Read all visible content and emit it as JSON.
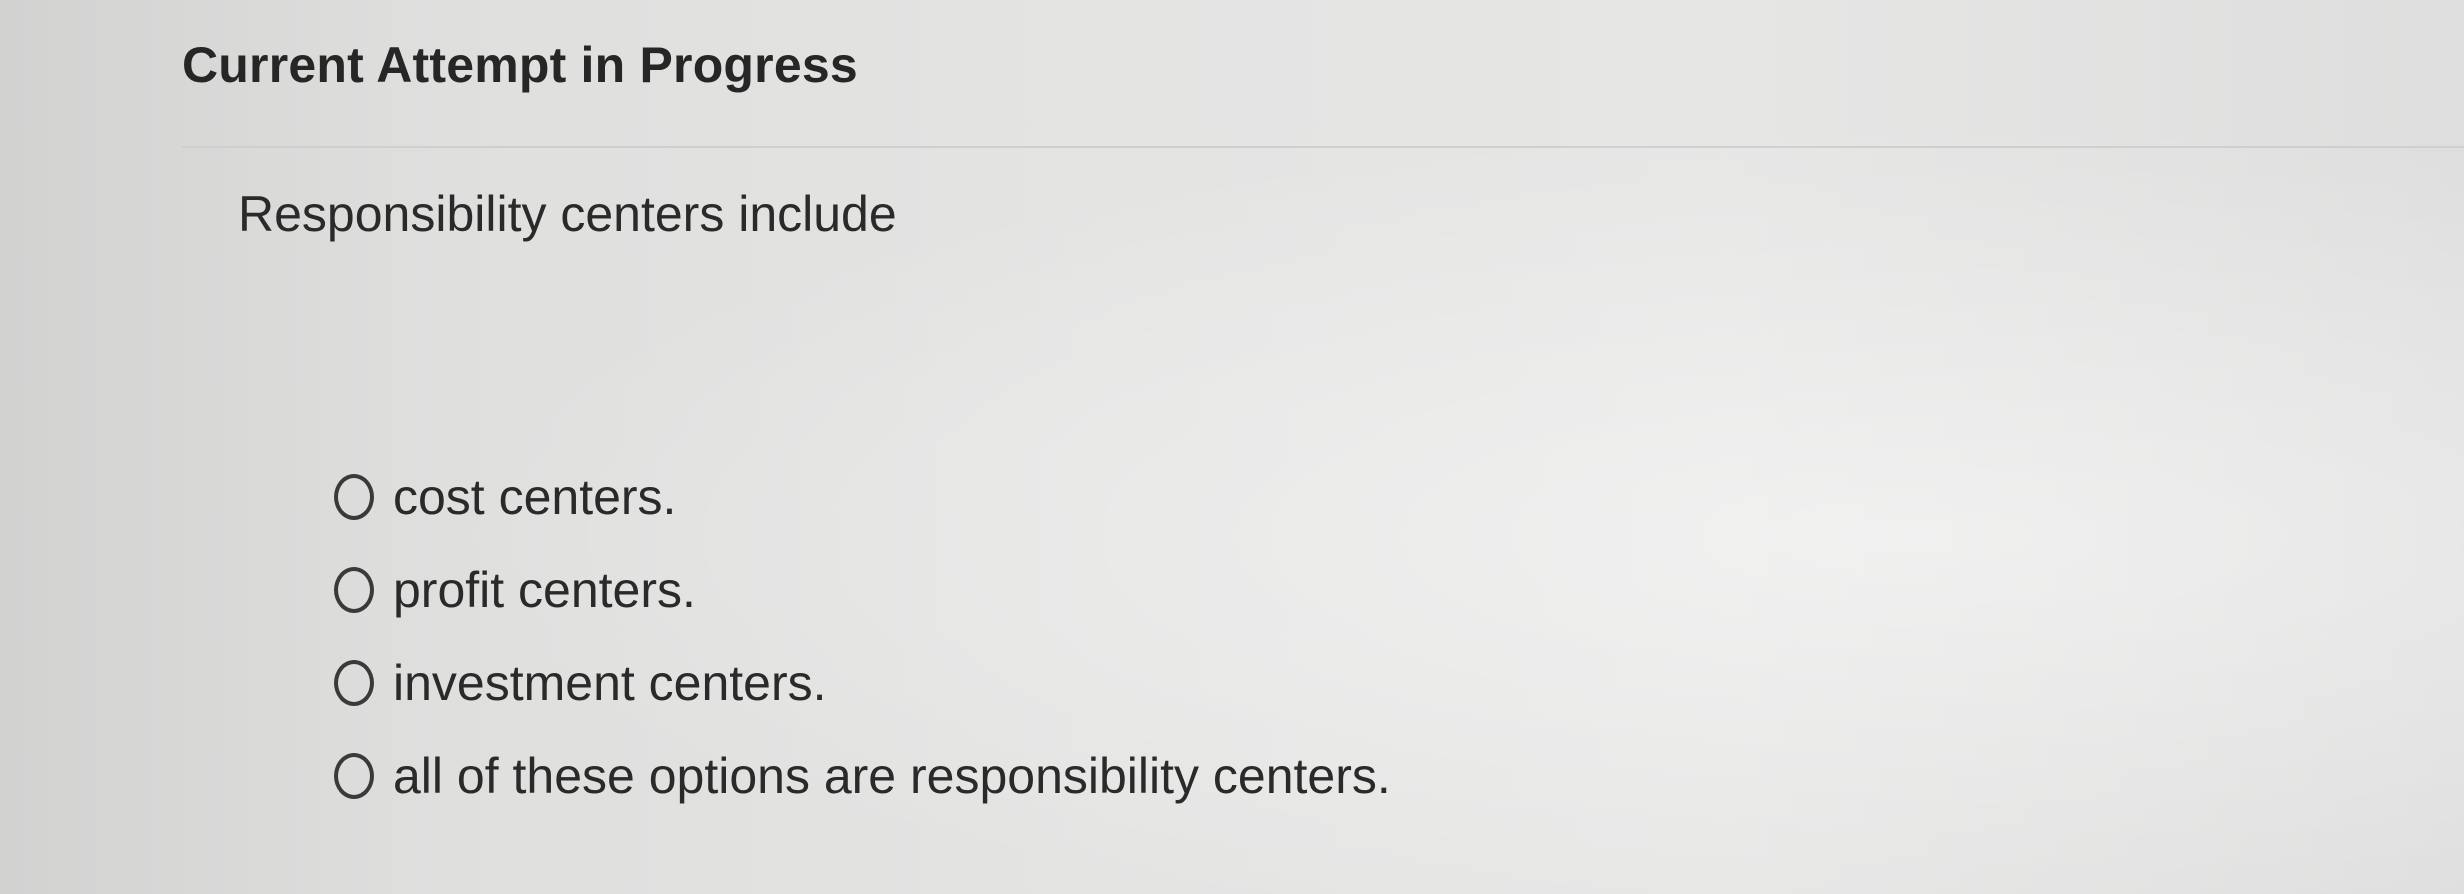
{
  "header": {
    "title": "Current Attempt in Progress"
  },
  "question": {
    "text": "Responsibility centers include"
  },
  "options": [
    {
      "label": "cost centers.",
      "selected": false
    },
    {
      "label": "profit centers.",
      "selected": false
    },
    {
      "label": "investment centers.",
      "selected": false
    },
    {
      "label": "all of these options are responsibility centers.",
      "selected": false
    }
  ]
}
